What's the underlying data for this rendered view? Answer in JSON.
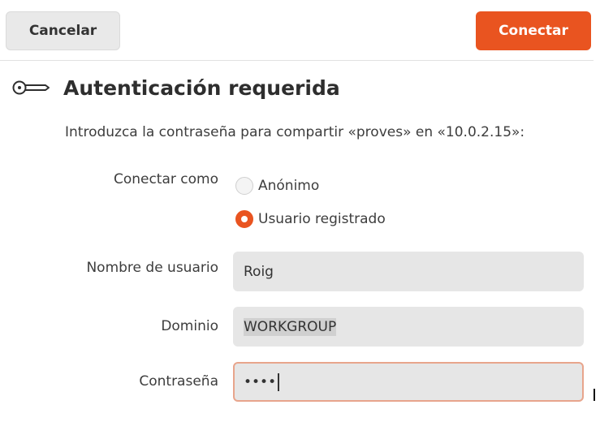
{
  "headerbar": {
    "cancel_label": "Cancelar",
    "connect_label": "Conectar"
  },
  "dialog": {
    "icon": "key-icon",
    "title": "Autenticación requerida",
    "description": "Introduzca la contraseña para compartir «proves» en «10.0.2.15»:"
  },
  "form": {
    "connect_as_label": "Conectar como",
    "options": [
      {
        "label": "Anónimo",
        "selected": false
      },
      {
        "label": "Usuario registrado",
        "selected": true
      }
    ],
    "username_label": "Nombre de usuario",
    "username_value": "Roig",
    "domain_label": "Dominio",
    "domain_value": "WORKGROUP",
    "password_label": "Contraseña",
    "password_value": "••••"
  },
  "colors": {
    "accent": "#e95420",
    "field_bg": "#e6e6e6",
    "focus_border": "#e8a58c"
  }
}
